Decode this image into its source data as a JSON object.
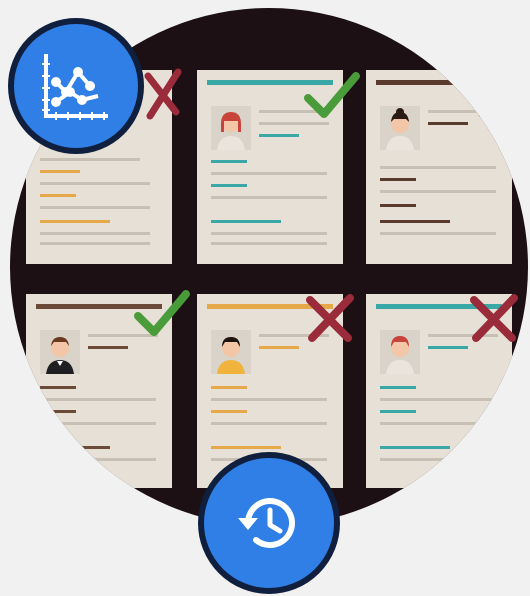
{
  "image": {
    "subject": "resume-screening",
    "icons": [
      "chart-icon",
      "history-icon"
    ],
    "colors": {
      "background": "#f1f1f1",
      "circle_bg": "#1c1014",
      "paper": "#e6e0d6",
      "badge_blue": "#2f7fe6",
      "badge_border": "#0f1f3d",
      "check_green": "#4a9b3a",
      "cross_red": "#9a2b3a"
    }
  }
}
